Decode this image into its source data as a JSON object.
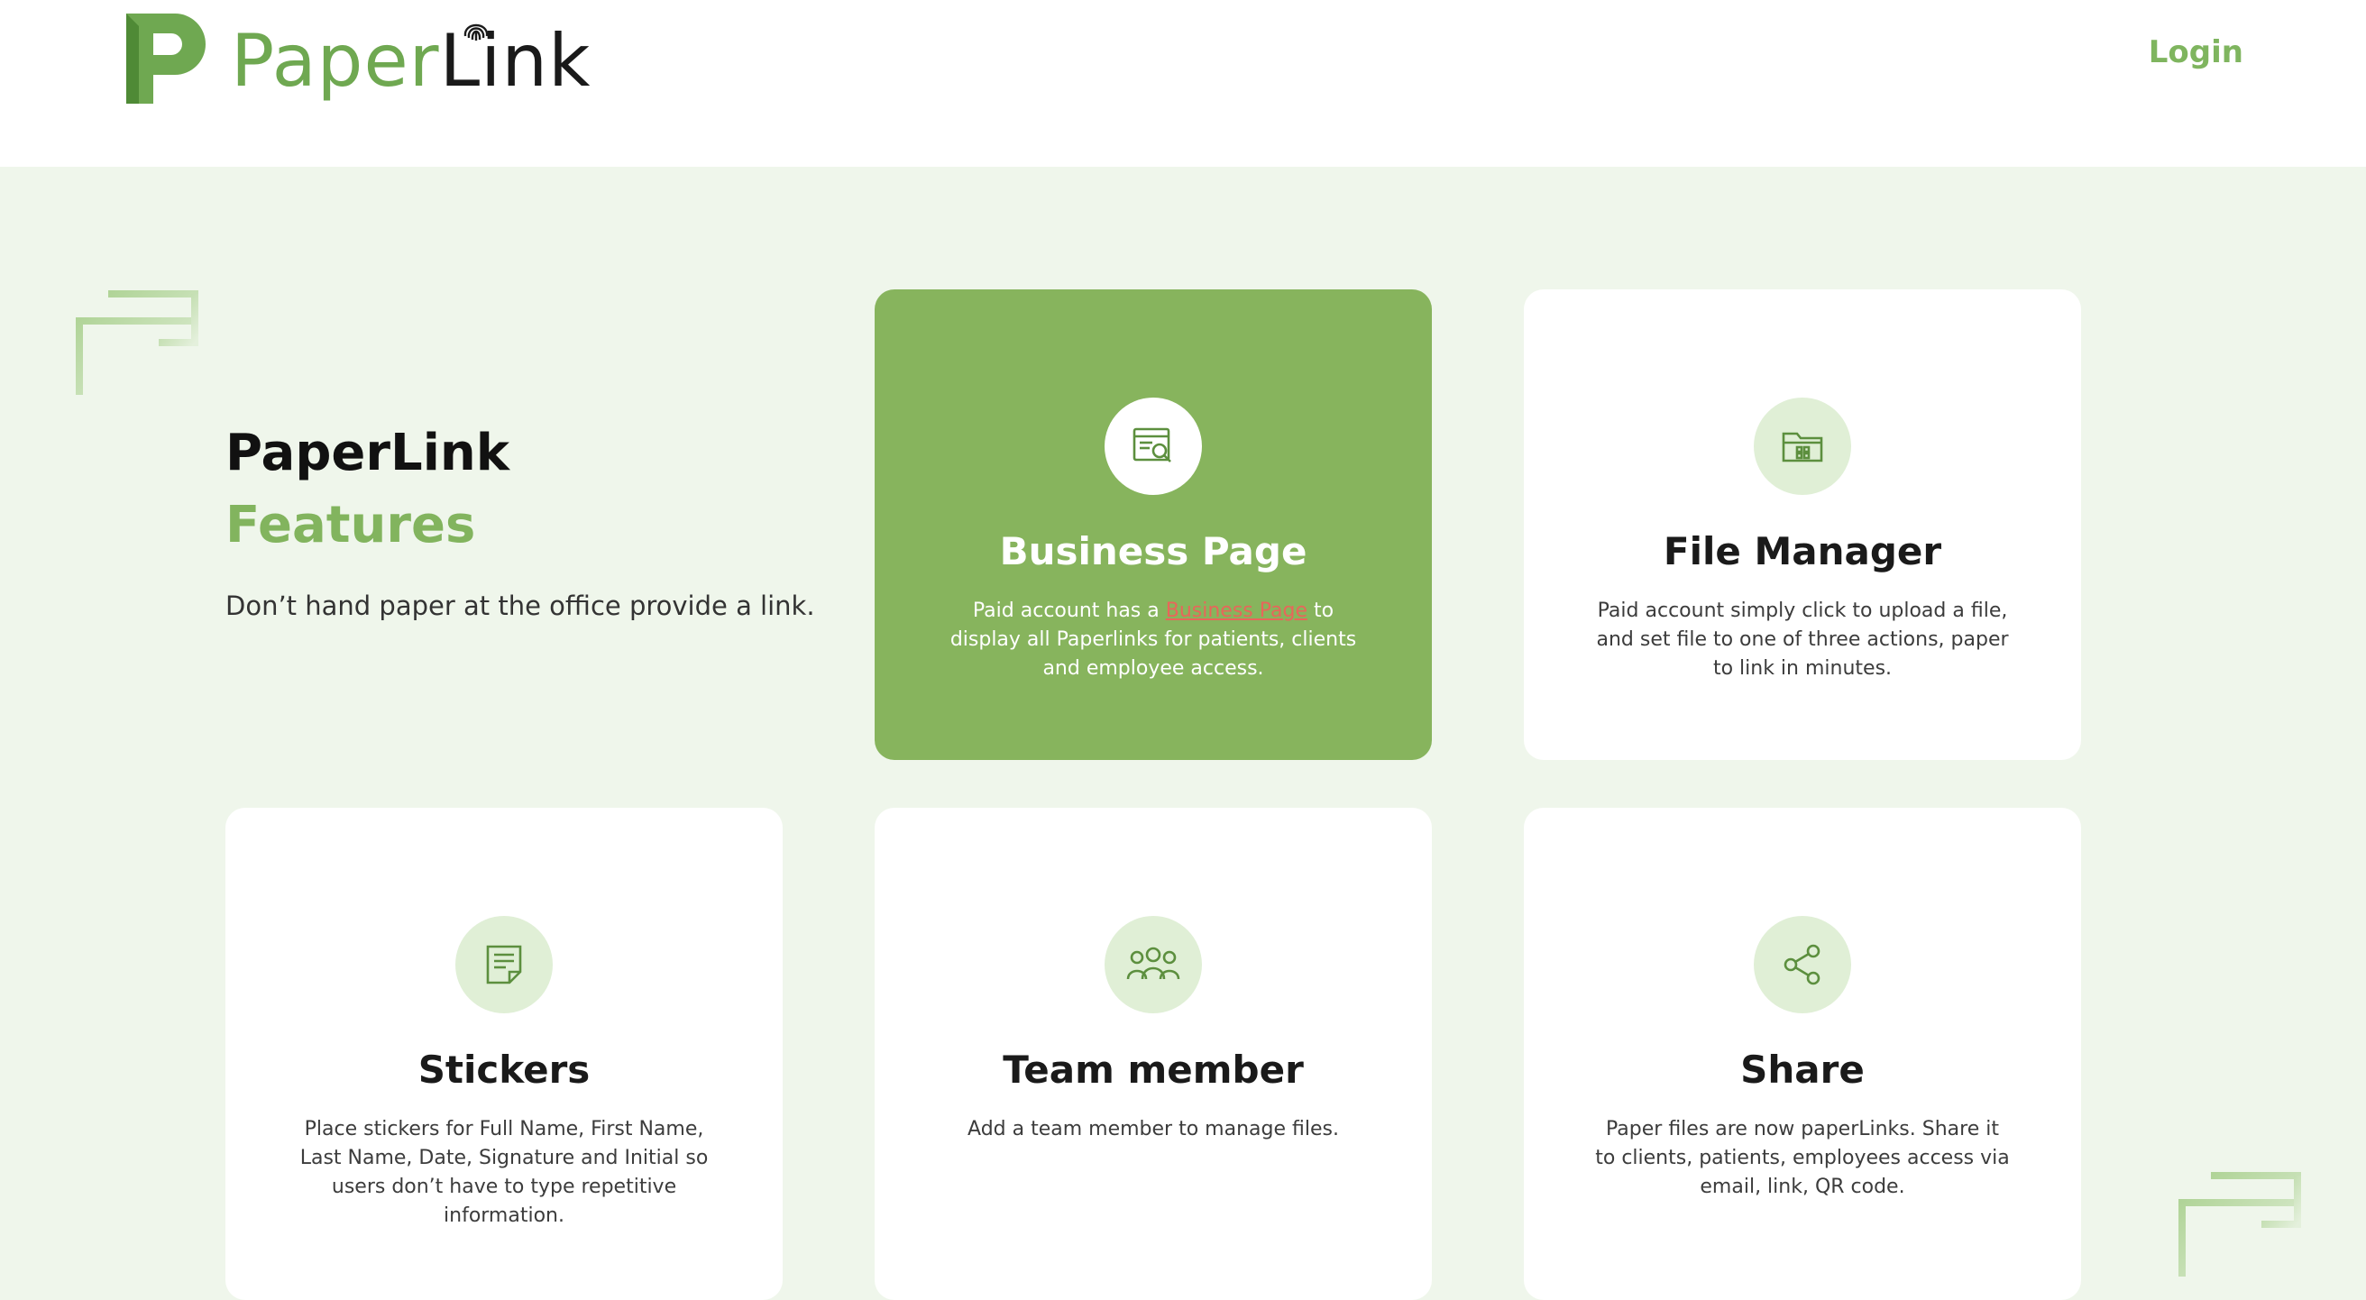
{
  "header": {
    "brand_part1": "Paper",
    "brand_part2": "Link",
    "login_label": "Login"
  },
  "intro": {
    "title": "PaperLink",
    "subtitle": "Features",
    "description": "Don’t hand paper at the office provide a link."
  },
  "cards": [
    {
      "title": "Business Page",
      "text_before": "Paid account has a ",
      "link_text": "Business Page",
      "text_after": " to display all Paperlinks for patients, clients and employee access.",
      "icon": "search-document-icon"
    },
    {
      "title": "File Manager",
      "text": "Paid account simply click to upload a file, and set file to one of three actions, paper to link in minutes.",
      "icon": "folder-icon"
    },
    {
      "title": "Stickers",
      "text": "Place stickers for Full Name, First Name, Last Name, Date, Signature and Initial so users don’t have to type repetitive information.",
      "icon": "sticker-note-icon"
    },
    {
      "title": "Team member",
      "text": "Add a team member to manage files.",
      "icon": "team-icon"
    },
    {
      "title": "Share",
      "text": "Paper files are now paperLinks. Share it to clients, patients, employees access via email, link, QR code.",
      "icon": "share-icon"
    }
  ],
  "colors": {
    "brand_green": "#82b45e",
    "card_active": "#87b45d",
    "background": "#eff6eb",
    "link_accent": "#e8665a"
  }
}
